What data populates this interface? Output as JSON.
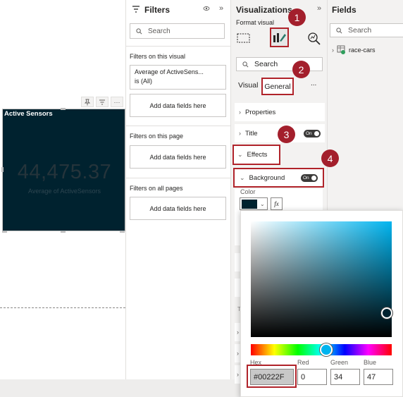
{
  "visual": {
    "title": "Active Sensors",
    "kpi_value": "44,475.37",
    "kpi_label": "Average of ActiveSensors",
    "background_color": "#00222f"
  },
  "filters": {
    "title": "Filters",
    "search_placeholder": "Search",
    "on_this_visual_label": "Filters on this visual",
    "visual_filter": {
      "field": "Average of ActiveSens...",
      "condition": "is (All)"
    },
    "add_fields_label": "Add data fields here",
    "on_this_page_label": "Filters on this page",
    "on_all_pages_label": "Filters on all pages"
  },
  "visualizations": {
    "title": "Visualizations",
    "format_visual_label": "Format visual",
    "search_placeholder": "Search",
    "tabs": [
      "Visual",
      "General"
    ],
    "active_tab": "General",
    "more": "...",
    "sections": {
      "properties": "Properties",
      "title": "Title",
      "effects": "Effects",
      "background": "Background"
    },
    "toggle_label": "On",
    "color_label": "Color",
    "fx_label": "fx"
  },
  "fields": {
    "title": "Fields",
    "search_placeholder": "Search",
    "tables": [
      "race-cars"
    ]
  },
  "color_picker": {
    "hex_label": "Hex",
    "red_label": "Red",
    "green_label": "Green",
    "blue_label": "Blue",
    "hex_value": "#00222F",
    "red_value": "0",
    "green_value": "34",
    "blue_value": "47"
  },
  "callouts": [
    "1",
    "2",
    "3",
    "4"
  ],
  "accent_colors": {
    "callout": "#a31f2c",
    "highlight_border": "#b0232a",
    "visual_bg": "#00222f"
  }
}
